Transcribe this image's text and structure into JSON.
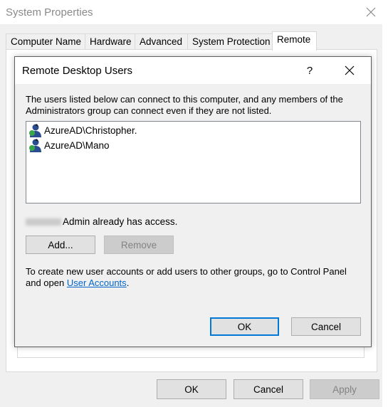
{
  "system_properties": {
    "title": "System Properties",
    "tabs": [
      {
        "label": "Computer Name"
      },
      {
        "label": "Hardware"
      },
      {
        "label": "Advanced"
      },
      {
        "label": "System Protection"
      },
      {
        "label": "Remote"
      }
    ],
    "active_tab": "Remote",
    "buttons": {
      "ok": "OK",
      "cancel": "Cancel",
      "apply": "Apply"
    }
  },
  "remote_desktop_users": {
    "title": "Remote Desktop Users",
    "help_glyph": "?",
    "description": "The users listed below can connect to this computer, and any members of the Administrators group can connect even if they are not listed.",
    "users": [
      {
        "name": "AzureAD\\Christopher."
      },
      {
        "name": "AzureAD\\Mano"
      }
    ],
    "access_note": "Admin already has access.",
    "add_label": "Add...",
    "remove_label": "Remove",
    "footer_text": "To create new user accounts or add users to other groups, go to Control Panel and open",
    "footer_link": "User Accounts",
    "footer_end": ".",
    "ok_label": "OK",
    "cancel_label": "Cancel"
  },
  "icons": {
    "close": "close-icon",
    "help": "help-icon",
    "user": "user-icon"
  },
  "colors": {
    "accent": "#0078d7",
    "link": "#0066cc",
    "window_bg": "#f0f0f0"
  }
}
